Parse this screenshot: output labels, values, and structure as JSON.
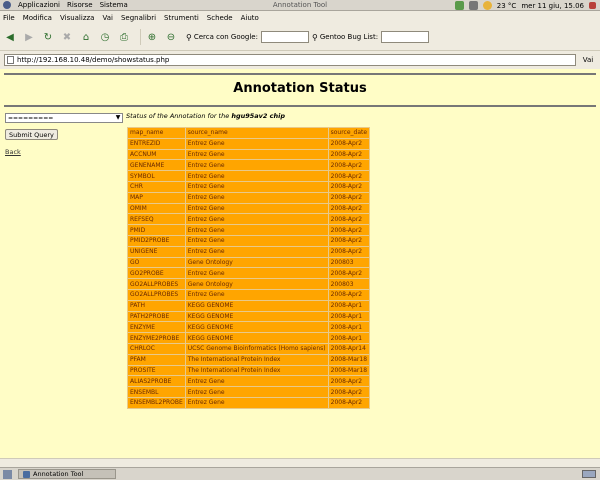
{
  "top_panel": {
    "menus": [
      "Applicazioni",
      "Risorse",
      "Sistema"
    ],
    "window_title": "Annotation Tool",
    "weather": "23 °C",
    "clock": "mer 11 giu, 15.06"
  },
  "menubar": [
    "File",
    "Modifica",
    "Visualizza",
    "Vai",
    "Segnalibri",
    "Strumenti",
    "Schede",
    "Aiuto"
  ],
  "toolbar": {
    "search_google_label": "Cerca con Google:",
    "gentoo_label": "Gentoo Bug List:"
  },
  "location": {
    "url": "http://192.168.10.48/demo/showstatus.php",
    "go_label": "Vai"
  },
  "page": {
    "title": "Annotation Status",
    "select_value": "=========",
    "status_prefix": "Status of the Annotation for the",
    "chip": "hgu95av2 chip",
    "submit_label": "Submit Query",
    "back_label": "Back"
  },
  "table": {
    "headers": [
      "map_name",
      "source_name",
      "source_date"
    ],
    "rows": [
      [
        "ENTREZID",
        "Entrez Gene",
        "2008-Apr2"
      ],
      [
        "ACCNUM",
        "Entrez Gene",
        "2008-Apr2"
      ],
      [
        "GENENAME",
        "Entrez Gene",
        "2008-Apr2"
      ],
      [
        "SYMBOL",
        "Entrez Gene",
        "2008-Apr2"
      ],
      [
        "CHR",
        "Entrez Gene",
        "2008-Apr2"
      ],
      [
        "MAP",
        "Entrez Gene",
        "2008-Apr2"
      ],
      [
        "OMIM",
        "Entrez Gene",
        "2008-Apr2"
      ],
      [
        "REFSEQ",
        "Entrez Gene",
        "2008-Apr2"
      ],
      [
        "PMID",
        "Entrez Gene",
        "2008-Apr2"
      ],
      [
        "PMID2PROBE",
        "Entrez Gene",
        "2008-Apr2"
      ],
      [
        "UNIGENE",
        "Entrez Gene",
        "2008-Apr2"
      ],
      [
        "GO",
        "Gene Ontology",
        "200803"
      ],
      [
        "GO2PROBE",
        "Entrez Gene",
        "2008-Apr2"
      ],
      [
        "GO2ALLPROBES",
        "Gene Ontology",
        "200803"
      ],
      [
        "GO2ALLPROBES",
        "Entrez Gene",
        "2008-Apr2"
      ],
      [
        "PATH",
        "KEGG GENOME",
        "2008-Apr1"
      ],
      [
        "PATH2PROBE",
        "KEGG GENOME",
        "2008-Apr1"
      ],
      [
        "ENZYME",
        "KEGG GENOME",
        "2008-Apr1"
      ],
      [
        "ENZYME2PROBE",
        "KEGG GENOME",
        "2008-Apr1"
      ],
      [
        "CHRLOC",
        "UCSC Genome Bioinformatics (Homo sapiens)",
        "2008-Apr14"
      ],
      [
        "PFAM",
        "The International Protein Index",
        "2008-Mar18"
      ],
      [
        "PROSITE",
        "The International Protein Index",
        "2008-Mar18"
      ],
      [
        "ALIAS2PROBE",
        "Entrez Gene",
        "2008-Apr2"
      ],
      [
        "ENSEMBL",
        "Entrez Gene",
        "2008-Apr2"
      ],
      [
        "ENSEMBL2PROBE",
        "Entrez Gene",
        "2008-Apr2"
      ]
    ]
  },
  "taskbar": {
    "window_label": "Annotation Tool"
  }
}
